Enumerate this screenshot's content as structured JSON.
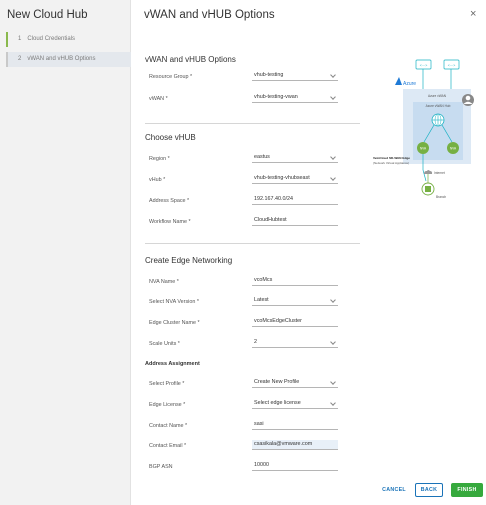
{
  "sidebar": {
    "title": "New Cloud Hub",
    "steps": [
      {
        "num": "1",
        "label": "Cloud Credentials"
      },
      {
        "num": "2",
        "label": "vWAN and vHUB Options"
      }
    ]
  },
  "header": {
    "title": "vWAN and vHUB Options",
    "close": "×"
  },
  "section1": {
    "title": "vWAN and vHUB Options",
    "resource_group": {
      "label": "Resource Group *",
      "value": "vhub-testing"
    },
    "vwan": {
      "label": "vWAN *",
      "value": "vhub-testing-vwan"
    }
  },
  "section2": {
    "title": "Choose vHUB",
    "region": {
      "label": "Region *",
      "value": "eastus"
    },
    "vhub": {
      "label": "vHub *",
      "value": "vhub-testing-vhubseast"
    },
    "address_space": {
      "label": "Address Space *",
      "value": "192.167.40.0/24"
    },
    "workflow_name": {
      "label": "Workflow Name *",
      "value": "CloudHubtest"
    }
  },
  "section3": {
    "title": "Create Edge Networking",
    "nva_name": {
      "label": "NVA Name *",
      "value": "vcoMcs"
    },
    "nva_version": {
      "label": "Select NVA Version *",
      "value": "Latest"
    },
    "edge_cluster": {
      "label": "Edge Cluster Name *",
      "value": "vcoMcsEdgeCluster"
    },
    "scale_units": {
      "label": "Scale Units *",
      "value": "2"
    },
    "address_assignment": "Address Assignment",
    "select_profile": {
      "label": "Select Profile *",
      "value": "Create New Profile"
    },
    "edge_license": {
      "label": "Edge License *",
      "value": "Select edge license"
    },
    "contact_name": {
      "label": "Contact Name *",
      "value": "sasi"
    },
    "contact_email": {
      "label": "Contact Email *",
      "value": "csasikala@vmware.com"
    },
    "bgp_asn": {
      "label": "BGP ASN",
      "value": "10000"
    }
  },
  "footer": {
    "cancel": "CANCEL",
    "back": "BACK",
    "finish": "FINISH"
  },
  "diagram": {
    "azure_label": "Azure",
    "vnet_label": "Azure vWAN",
    "hub_label": "Azure vWAN Hub",
    "nva_left": "NVA",
    "nva_right": "NVA",
    "nva_caption": "VeloCloud SD-WAN Edge",
    "nva_caption2": "(Network Virtual Appliance)",
    "internet_label": "Internet",
    "branch_label": "Branch",
    "vpn_label": "<···>"
  },
  "colors": {
    "accent": "#1a73b8",
    "finish": "#36a93d",
    "step_active": "#8ab94d",
    "diagram_teal": "#1ab1c3",
    "diagram_green": "#76b043"
  }
}
